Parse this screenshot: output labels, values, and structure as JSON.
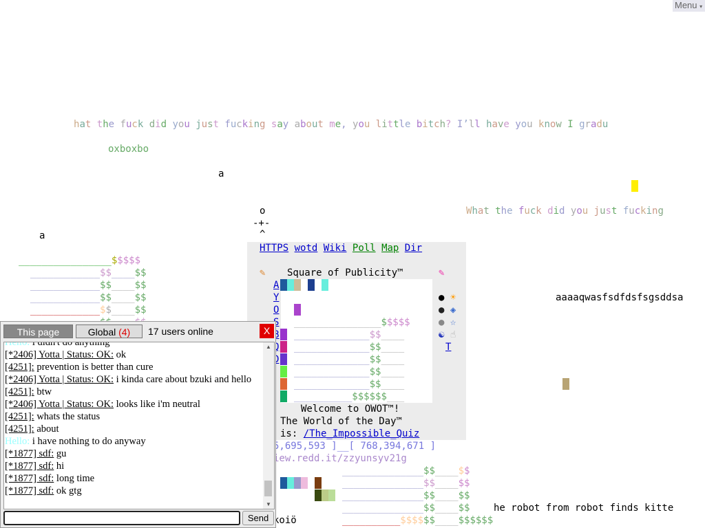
{
  "menu": {
    "label": "Menu",
    "caret": "▾"
  },
  "world": {
    "line_main": "hat the fuck did you just fucking say about me, you little bitch? I’ll have you know I gradu",
    "line_oxbo": "oxboxbo",
    "letter_a1": "a",
    "letter_a2": "a",
    "cursor_o": "o",
    "cursor_plus": "-+-",
    "cursor_caret": "^",
    "line_right": "What the fuck did you just fucking",
    "line_aaaa": "aaaaqwasfsdfdsfsgsddsa",
    "welcome": "Welcome to OWOT™!",
    "wotd_line1": "The World of the Day™",
    "wotd_prefix": "is: ",
    "wotd_link": "/The_Impossible_Quiz",
    "coords": "5,695,593 ]__[ 768,394,671 ]",
    "redd": "iew.redd.it/zzyunsyv21g",
    "robot": "he robot from robot finds kitte",
    "koio": "koiö",
    "square_title": "Square of Publicity™",
    "side_letters": [
      "A",
      "Y",
      "O",
      "S",
      "B",
      "Q",
      "D"
    ],
    "t_link": "T"
  },
  "nav": {
    "links": [
      {
        "label": "HTTPS",
        "color": "#0000cc"
      },
      {
        "label": "wotd",
        "color": "#0000cc"
      },
      {
        "label": "Wiki",
        "color": "#0000cc"
      },
      {
        "label": "Poll",
        "color": "#008000"
      },
      {
        "label": "Map",
        "color": "#008000"
      },
      {
        "label": "Dir",
        "color": "#0000cc"
      }
    ]
  },
  "chat": {
    "tab_page": "This page",
    "tab_global": "Global",
    "global_count": "(4)",
    "online": "17 users online",
    "close": "X",
    "send": "Send",
    "input_value": "",
    "messages": [
      {
        "who": "Hello:",
        "text": " i didn't do anything",
        "color": "#9ff"
      },
      {
        "who": "[*2406] Yotta | Status: OK:",
        "text": " ok"
      },
      {
        "who": "[4251]:",
        "text": " prevention is better than cure"
      },
      {
        "who": "[*2406] Yotta | Status: OK:",
        "text": " i kinda care about bzuki and hello"
      },
      {
        "who": "[4251]:",
        "text": " btw"
      },
      {
        "who": "[*2406] Yotta | Status: OK:",
        "text": " looks like i'm neutral"
      },
      {
        "who": "[4251]:",
        "text": " whats the status"
      },
      {
        "who": "[4251]:",
        "text": " about"
      },
      {
        "who": "Hello:",
        "text": " i have nothing to do anyway",
        "color": "#9ff"
      },
      {
        "who": "[*1877] sdf:",
        "text": " gu"
      },
      {
        "who": "[*1877] sdf:",
        "text": " hi"
      },
      {
        "who": "[*1877] sdf:",
        "text": " long time"
      },
      {
        "who": "[*1877] sdf:",
        "text": " ok gtg"
      }
    ]
  },
  "colors": {
    "accent_close": "#e00000",
    "global_count": "#dd0000",
    "grey_panel": "#ececec"
  }
}
